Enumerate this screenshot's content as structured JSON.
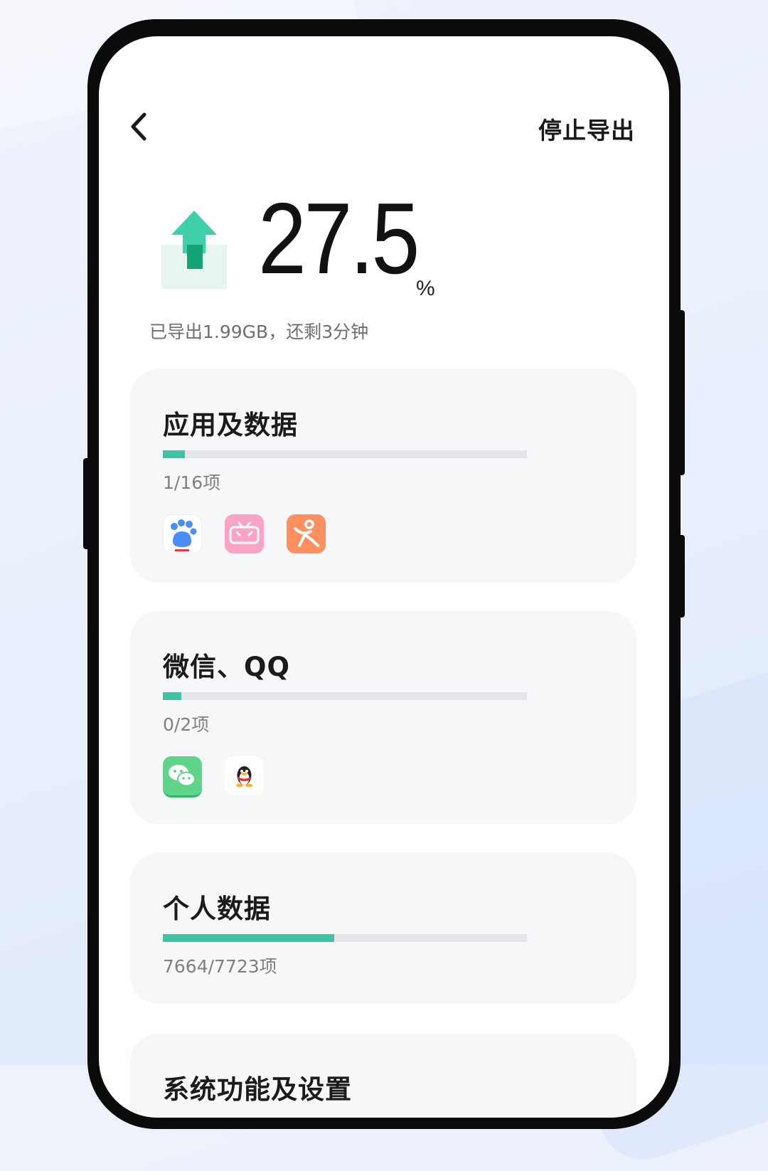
{
  "header": {
    "back_icon": "chevron-left-icon",
    "stop_label": "停止导出"
  },
  "progress": {
    "value": "27.5",
    "unit": "%",
    "status": "已导出1.99GB，还剩3分钟",
    "icon": "upload-arrow-icon"
  },
  "colors": {
    "accent": "#3cc4a4",
    "track": "#e4e5e8",
    "card_bg": "#f6f7f9"
  },
  "categories": [
    {
      "title": "应用及数据",
      "count": "1/16项",
      "progress": 0.06,
      "apps": [
        "baidu-app-icon",
        "bilibili-app-icon",
        "dianping-app-icon"
      ]
    },
    {
      "title": "微信、QQ",
      "count": "0/2项",
      "progress": 0.05,
      "apps": [
        "wechat-app-icon",
        "qq-app-icon"
      ]
    },
    {
      "title": "个人数据",
      "count": "7664/7723项",
      "progress": 0.47,
      "apps": []
    },
    {
      "title": "系统功能及设置"
    }
  ]
}
